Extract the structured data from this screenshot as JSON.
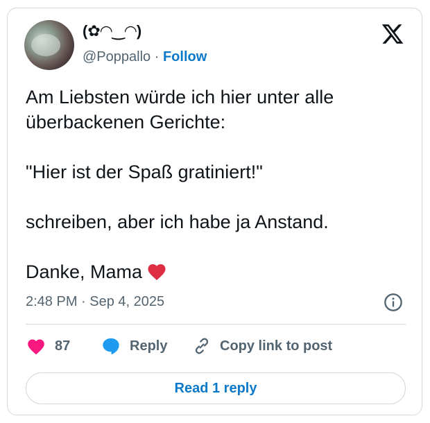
{
  "author": {
    "display_name": "(✿◠‿◠)",
    "handle": "@Poppallo",
    "separator": "·",
    "follow_label": "Follow"
  },
  "tweet": {
    "text": "Am Liebsten würde ich hier unter alle überbackenen Gerichte:\n\n\"Hier ist der Spaß gratiniert!\"\n\nschreiben, aber ich habe ja Anstand.\n\nDanke, Mama",
    "trailing_emoji": "heart-icon",
    "timestamp": "2:48 PM · Sep 4, 2025"
  },
  "actions": {
    "like_count": "87",
    "reply_label": "Reply",
    "copy_label": "Copy link to post"
  },
  "read_replies_label": "Read 1 reply",
  "colors": {
    "heart": "#f91880",
    "inline_heart": "#e0245e",
    "reply_bubble": "#1d9bf0",
    "link_blue": "#0b79c9",
    "muted": "#536471",
    "border": "#cfd9de"
  }
}
